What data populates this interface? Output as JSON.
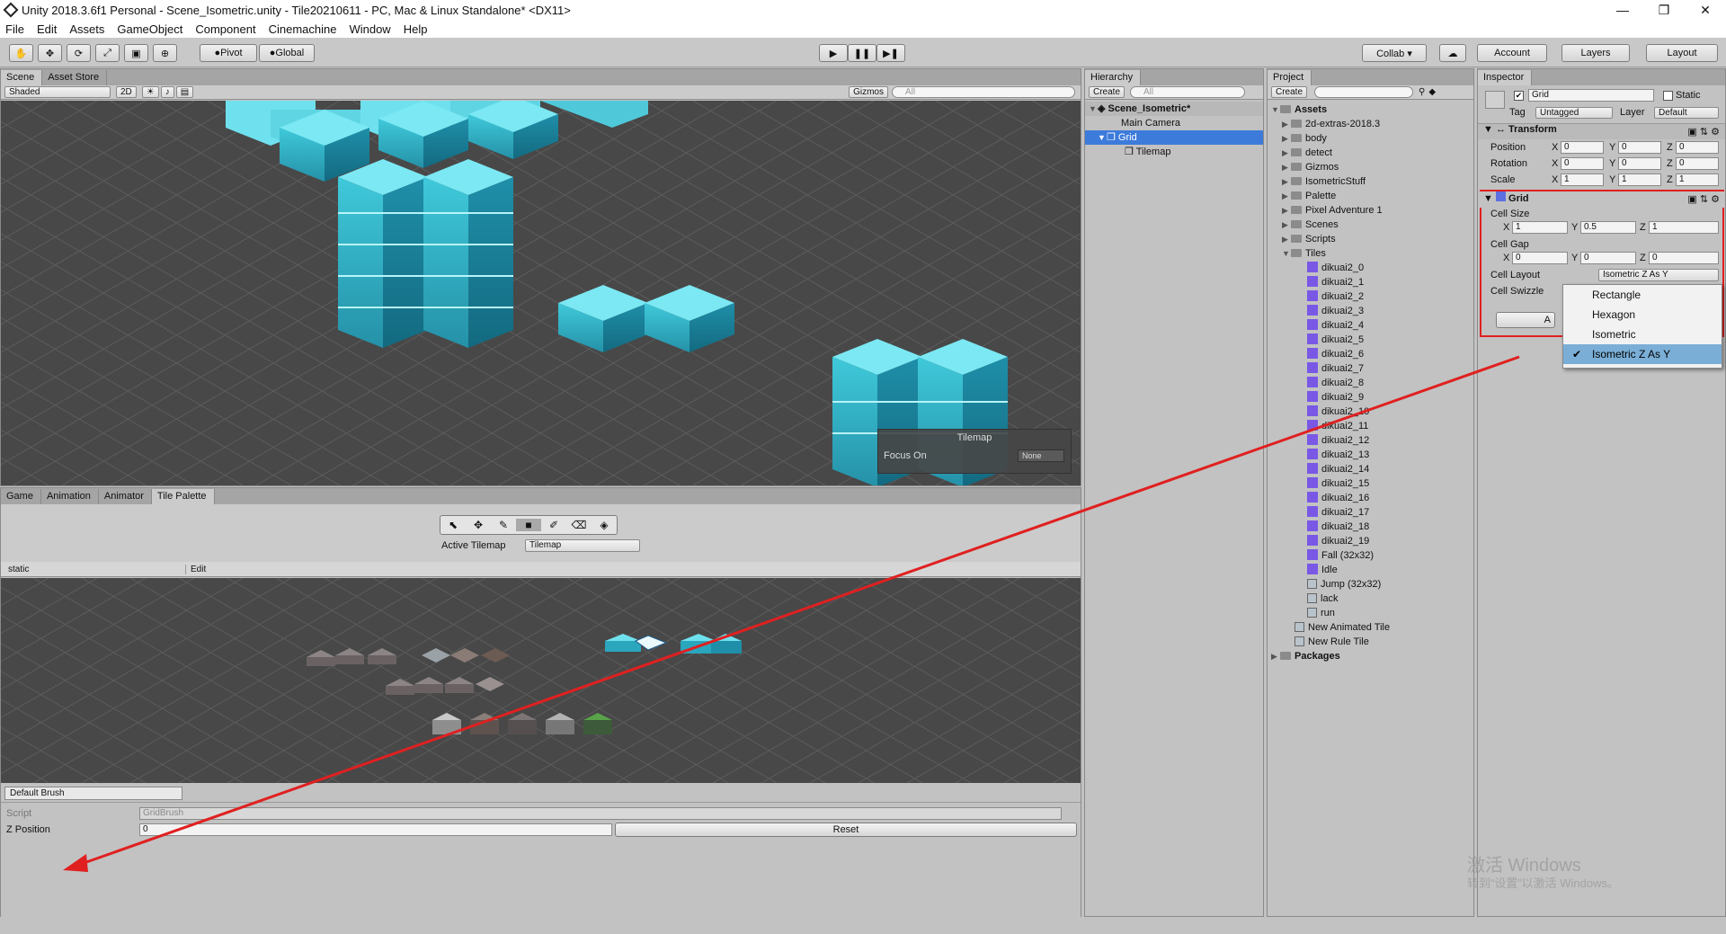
{
  "window": {
    "title": "Unity 2018.3.6f1 Personal - Scene_Isometric.unity - Tile20210611 - PC, Mac & Linux Standalone* <DX11>",
    "controls": [
      "—",
      "❐",
      "✕"
    ]
  },
  "menu": [
    "File",
    "Edit",
    "Assets",
    "GameObject",
    "Component",
    "Cinemachine",
    "Window",
    "Help"
  ],
  "toolbar": {
    "pivot": "Pivot",
    "global": "Global",
    "collab": "Collab ▾",
    "account": "Account",
    "layers": "Layers",
    "layout": "Layout"
  },
  "scene": {
    "tabs": [
      "Scene",
      "Asset Store"
    ],
    "shading": "Shaded",
    "mode2d": "2D",
    "gizmos": "Gizmos",
    "search": "All",
    "overlay_title": "Tilemap",
    "focus_label": "Focus On",
    "focus_value": "None"
  },
  "palette": {
    "tabs": [
      "Game",
      "Animation",
      "Animator",
      "Tile Palette"
    ],
    "active_tilemap_label": "Active Tilemap",
    "active_tilemap_value": "Tilemap",
    "palette_name": "static",
    "edit": "Edit",
    "brush": "Default Brush",
    "script_label": "Script",
    "script_value": "GridBrush",
    "zpos_label": "Z Position",
    "zpos_value": "0",
    "reset": "Reset"
  },
  "hierarchy": {
    "tab": "Hierarchy",
    "create": "Create",
    "search": "All",
    "scene": "Scene_Isometric*",
    "items": [
      "Main Camera",
      "Grid",
      "Tilemap"
    ]
  },
  "project": {
    "tab": "Project",
    "create": "Create",
    "assets_label": "Assets",
    "folders": [
      "2d-extras-2018.3",
      "body",
      "detect",
      "Gizmos",
      "IsometricStuff",
      "Palette",
      "Pixel Adventure 1",
      "Scenes",
      "Scripts"
    ],
    "tiles_folder": "Tiles",
    "tiles": [
      "dikuai2_0",
      "dikuai2_1",
      "dikuai2_2",
      "dikuai2_3",
      "dikuai2_4",
      "dikuai2_5",
      "dikuai2_6",
      "dikuai2_7",
      "dikuai2_8",
      "dikuai2_9",
      "dikuai2_10",
      "dikuai2_11",
      "dikuai2_12",
      "dikuai2_13",
      "dikuai2_14",
      "dikuai2_15",
      "dikuai2_16",
      "dikuai2_17",
      "dikuai2_18",
      "dikuai2_19",
      "Fall (32x32)",
      "Idle",
      "Jump (32x32)",
      "lack",
      "run"
    ],
    "root_assets": [
      "New Animated Tile",
      "New Rule Tile"
    ],
    "packages": "Packages"
  },
  "inspector": {
    "tab": "Inspector",
    "name": "Grid",
    "static": "Static",
    "tag_label": "Tag",
    "tag": "Untagged",
    "layer_label": "Layer",
    "layer": "Default",
    "transform": {
      "title": "Transform",
      "rows": [
        {
          "label": "Position",
          "x": "0",
          "y": "0",
          "z": "0"
        },
        {
          "label": "Rotation",
          "x": "0",
          "y": "0",
          "z": "0"
        },
        {
          "label": "Scale",
          "x": "1",
          "y": "1",
          "z": "1"
        }
      ]
    },
    "grid": {
      "title": "Grid",
      "cell_size_label": "Cell Size",
      "cell_size": {
        "x": "1",
        "y": "0.5",
        "z": "1"
      },
      "cell_gap_label": "Cell Gap",
      "cell_gap": {
        "x": "0",
        "y": "0",
        "z": "0"
      },
      "cell_layout_label": "Cell Layout",
      "cell_layout": "Isometric Z As Y",
      "cell_swizzle_label": "Cell Swizzle",
      "add_btn": "A"
    },
    "dropdown": [
      "Rectangle",
      "Hexagon",
      "Isometric",
      "Isometric Z As Y"
    ],
    "dropdown_selected": "Isometric Z As Y"
  },
  "watermark": {
    "line1": "激活 Windows",
    "line2": "转到“设置”以激活 Windows。"
  },
  "annotation_color": "#e02020"
}
